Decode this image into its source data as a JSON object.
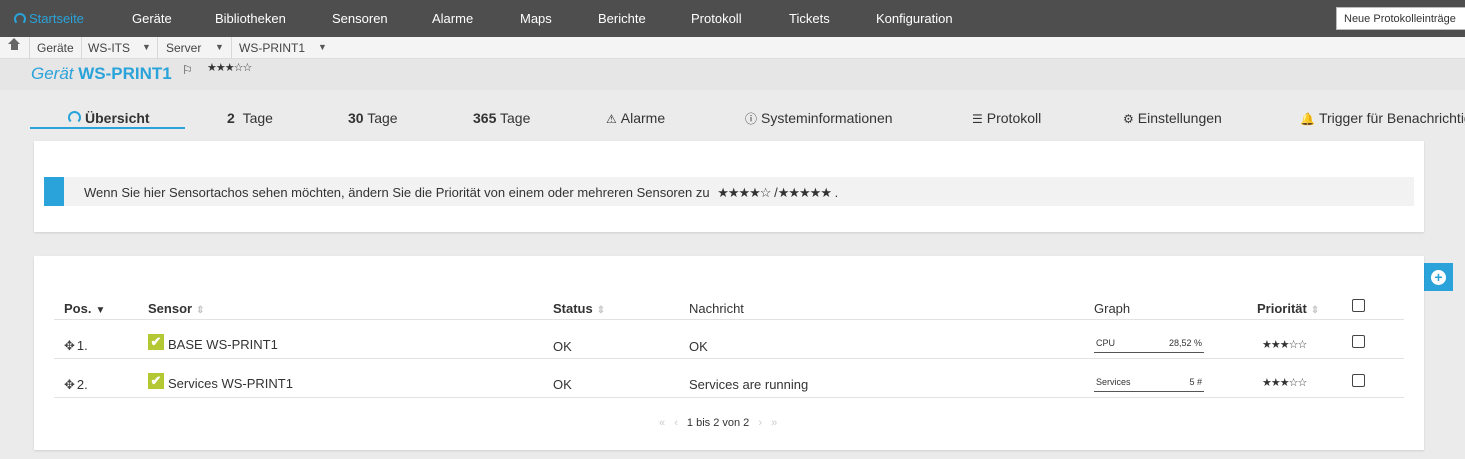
{
  "nav": {
    "home": "Startseite",
    "items": [
      "Geräte",
      "Bibliotheken",
      "Sensoren",
      "Alarme",
      "Maps",
      "Berichte",
      "Protokoll",
      "Tickets",
      "Konfiguration"
    ],
    "log_button": "Neue Protokolleinträge"
  },
  "breadcrumb": [
    "Geräte",
    "WS-ITS",
    "Server",
    "WS-PRINT1"
  ],
  "device": {
    "label": "Gerät",
    "name": "WS-PRINT1",
    "flag_icon": "flag-icon",
    "priority_stars": "★★★☆☆"
  },
  "tabs": {
    "overview": "Übersicht",
    "two_days_num": "2",
    "two_days": "Tage",
    "thirty_num": "30",
    "thirty": "Tage",
    "year_num": "365",
    "year": "Tage",
    "alarms": "Alarme",
    "sysinfo": "Systeminformationen",
    "log": "Protokoll",
    "settings": "Einstellungen",
    "triggers": "Trigger für Benachrichtigungen"
  },
  "info": {
    "text": "Wenn Sie hier Sensortachos sehen möchten, ändern Sie die Priorität von einem oder mehreren Sensoren zu",
    "stars_a": "★★★★☆",
    "sep": "/",
    "stars_b": "★★★★★",
    "end": "."
  },
  "table": {
    "headers": {
      "pos": "Pos.",
      "sensor": "Sensor",
      "status": "Status",
      "message": "Nachricht",
      "graph": "Graph",
      "priority": "Priorität"
    },
    "rows": [
      {
        "pos": "1.",
        "sensor": "BASE WS-PRINT1",
        "status": "OK",
        "message": "OK",
        "graph_label": "CPU",
        "graph_value": "28,52 %",
        "priority": "★★★☆☆"
      },
      {
        "pos": "2.",
        "sensor": "Services WS-PRINT1",
        "status": "OK",
        "message": "Services are running",
        "graph_label": "Services",
        "graph_value": "5 #",
        "priority": "★★★☆☆"
      }
    ],
    "pager": "1 bis 2 von 2"
  },
  "colors": {
    "accent": "#2aa3da",
    "nav_bg": "#4e4e4e",
    "status_ok": "#b4c834"
  }
}
